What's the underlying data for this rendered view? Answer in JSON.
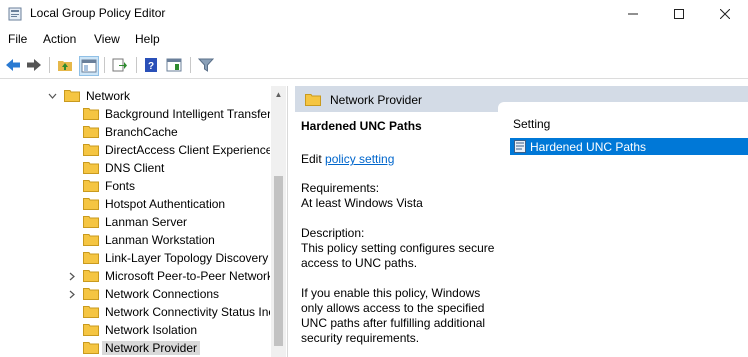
{
  "window": {
    "title": "Local Group Policy Editor"
  },
  "menu": {
    "items": [
      "File",
      "Action",
      "View",
      "Help"
    ]
  },
  "toolbar": {
    "buttons": [
      "back-icon",
      "forward-icon",
      "up-folder-icon",
      "show-hide-tree-icon",
      "export-list-icon",
      "help-icon",
      "extended-view-icon",
      "filter-icon"
    ]
  },
  "tree": {
    "parent": {
      "label": "Network"
    },
    "items": [
      {
        "label": "Background Intelligent Transfer",
        "expandable": false
      },
      {
        "label": "BranchCache",
        "expandable": false
      },
      {
        "label": "DirectAccess Client Experience S",
        "expandable": false
      },
      {
        "label": "DNS Client",
        "expandable": false
      },
      {
        "label": "Fonts",
        "expandable": false
      },
      {
        "label": "Hotspot Authentication",
        "expandable": false
      },
      {
        "label": "Lanman Server",
        "expandable": false
      },
      {
        "label": "Lanman Workstation",
        "expandable": false
      },
      {
        "label": "Link-Layer Topology Discovery",
        "expandable": false
      },
      {
        "label": "Microsoft Peer-to-Peer Network",
        "expandable": true
      },
      {
        "label": "Network Connections",
        "expandable": true
      },
      {
        "label": "Network Connectivity Status Inc",
        "expandable": false
      },
      {
        "label": "Network Isolation",
        "expandable": false
      },
      {
        "label": "Network Provider",
        "expandable": false,
        "selected": true
      }
    ]
  },
  "right": {
    "header": "Network Provider",
    "description": {
      "title": "Hardened UNC Paths",
      "edit_prefix": "Edit",
      "edit_link": "policy setting",
      "requirements_label": "Requirements:",
      "requirements_value": "At least Windows Vista",
      "description_label": "Description:",
      "description_text": "This policy setting configures secure access to UNC paths.",
      "extra_text": "If you enable this policy, Windows only allows access to the specified UNC paths after fulfilling additional security requirements."
    },
    "list": {
      "column_header": "Setting",
      "rows": [
        {
          "label": "Hardened UNC Paths",
          "selected": true
        }
      ]
    }
  },
  "colors": {
    "selection": "#0078d7",
    "link": "#0066cc",
    "header_band": "#d3dbe6",
    "folder": "#f5c542"
  }
}
